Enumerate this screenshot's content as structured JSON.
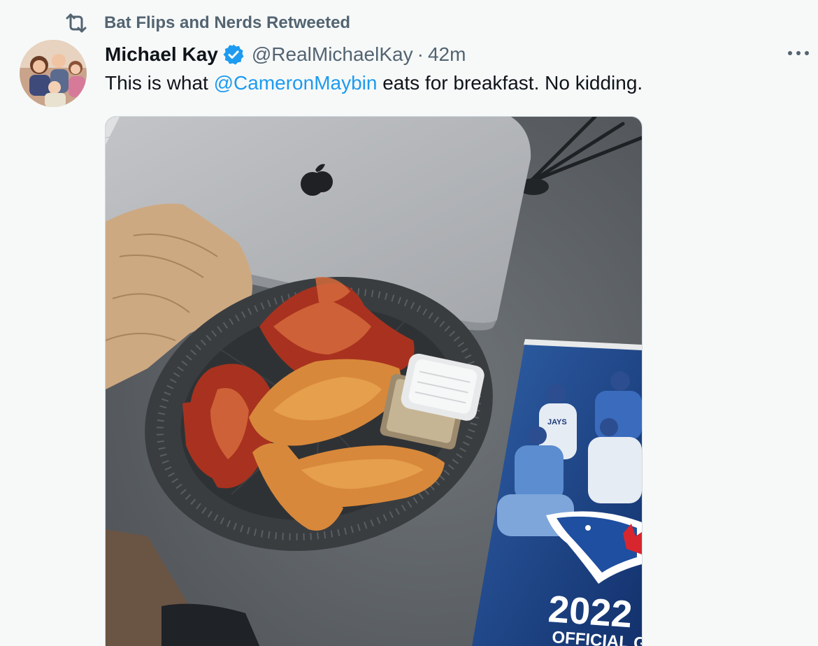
{
  "retweet": {
    "label": "Bat Flips and Nerds Retweeted",
    "icon": "retweet-icon"
  },
  "author": {
    "display_name": "Michael Kay",
    "verified": true,
    "handle": "@RealMichaelKay",
    "separator": "·",
    "time": "42m"
  },
  "tweet": {
    "text_before": "This is what ",
    "mention": "@CameronMaybin",
    "text_after": " eats for breakfast. No kidding."
  },
  "media": {
    "guide_year": "2022",
    "guide_subtitle": "OFFICIAL GUI",
    "jersey_text": "JAYS"
  },
  "colors": {
    "accent": "#1d9bf0",
    "secondary_text": "#536471",
    "background": "#f7f9f9"
  },
  "icons": [
    "retweet-icon",
    "verified-badge-icon",
    "more-icon"
  ]
}
